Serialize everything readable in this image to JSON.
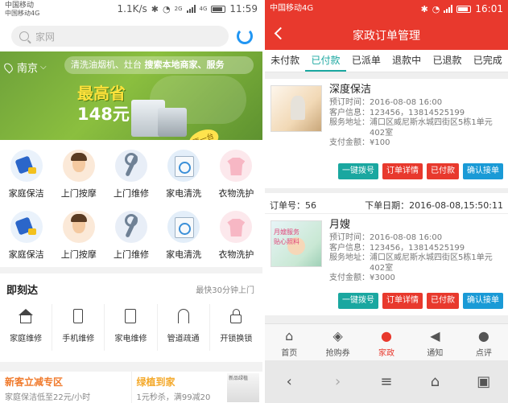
{
  "left": {
    "status": {
      "carrier": "中国移动",
      "carrier2": "中国移动4G",
      "speed": "1.1K/s",
      "net": "2G",
      "net2": "4G",
      "time": "11:59"
    },
    "search": {
      "placeholder": "家网"
    },
    "banner": {
      "city": "南京",
      "search_text": "清洗油烟机、灶台",
      "search_hint": "搜索本地商家、服务",
      "promo_line1": "最高省",
      "promo_line2": "148元",
      "tag": "再一台"
    },
    "grid": [
      [
        {
          "label": "家庭保洁",
          "icon": "cleaning-icon"
        },
        {
          "label": "上门按摩",
          "icon": "massage-icon"
        },
        {
          "label": "上门维修",
          "icon": "wrench-icon"
        },
        {
          "label": "家电清洗",
          "icon": "washer-icon"
        },
        {
          "label": "衣物洗护",
          "icon": "shirt-icon"
        }
      ],
      [
        {
          "label": "家庭保洁",
          "icon": "cleaning-icon"
        },
        {
          "label": "上门按摩",
          "icon": "massage-icon"
        },
        {
          "label": "上门维修",
          "icon": "wrench-icon"
        },
        {
          "label": "家电清洗",
          "icon": "washer-icon"
        },
        {
          "label": "衣物洗护",
          "icon": "shirt-icon"
        }
      ]
    ],
    "instant": {
      "title": "即刻达",
      "subtitle": "最快30分钟上门",
      "items": [
        {
          "label": "家庭维修",
          "icon": "home-icon"
        },
        {
          "label": "手机维修",
          "icon": "phone-icon"
        },
        {
          "label": "家电维修",
          "icon": "appliance-icon"
        },
        {
          "label": "管道疏通",
          "icon": "pipe-icon"
        },
        {
          "label": "开锁换锁",
          "icon": "lock-icon"
        }
      ]
    },
    "promos": [
      {
        "title": "新客立减专区",
        "subtitle": "家庭保洁低至22元/小时",
        "color": "#f07a2c"
      },
      {
        "title": "绿植到家",
        "subtitle": "1元秒杀，满99减20",
        "color": "#f4a92b",
        "thumb": "新品绿植"
      }
    ]
  },
  "right": {
    "status": {
      "carrier": "中国移动4G",
      "time": "16:01"
    },
    "title": "家政订单管理",
    "tabs": [
      "未付款",
      "已付款",
      "已派单",
      "退款中",
      "已退款",
      "已完成"
    ],
    "active_tab": 1,
    "orders": [
      {
        "name": "深度保洁",
        "time": "预订时间：2016-08-08 16:00",
        "info": "客户信息：123456，13814525199",
        "addr1": "服务地址：浦口区威尼斯水城四街区5栋1单元",
        "addr2": "402室",
        "amount": "支付金额：¥100",
        "buttons": [
          "一键拨号",
          "订单详情",
          "已付款",
          "确认接单"
        ]
      },
      {
        "order_no": "订单号：56",
        "order_date": "下单日期：2016-08-08,15:50:11",
        "name": "月嫂",
        "thumb_caption1": "月嫂服务",
        "thumb_caption2": "贴心照料",
        "time": "预订时间：2016-08-08 16:00",
        "info": "客户信息：123456，13814525199",
        "addr1": "服务地址：浦口区威尼斯水城四街区5栋1单元",
        "addr2": "402室",
        "amount": "支付金额：¥3000",
        "buttons": [
          "一键拨号",
          "订单详情",
          "已付款",
          "确认接单"
        ]
      }
    ],
    "nav": [
      {
        "label": "首页",
        "icon": "home-icon"
      },
      {
        "label": "抢购券",
        "icon": "tag-icon"
      },
      {
        "label": "家政",
        "icon": "paw-icon"
      },
      {
        "label": "通知",
        "icon": "speaker-icon"
      },
      {
        "label": "点评",
        "icon": "chat-icon"
      }
    ],
    "active_nav": 2
  },
  "colors": {
    "accent_red": "#e8392d",
    "accent_teal": "#1aa7a0",
    "accent_blue": "#1a9ad6"
  }
}
